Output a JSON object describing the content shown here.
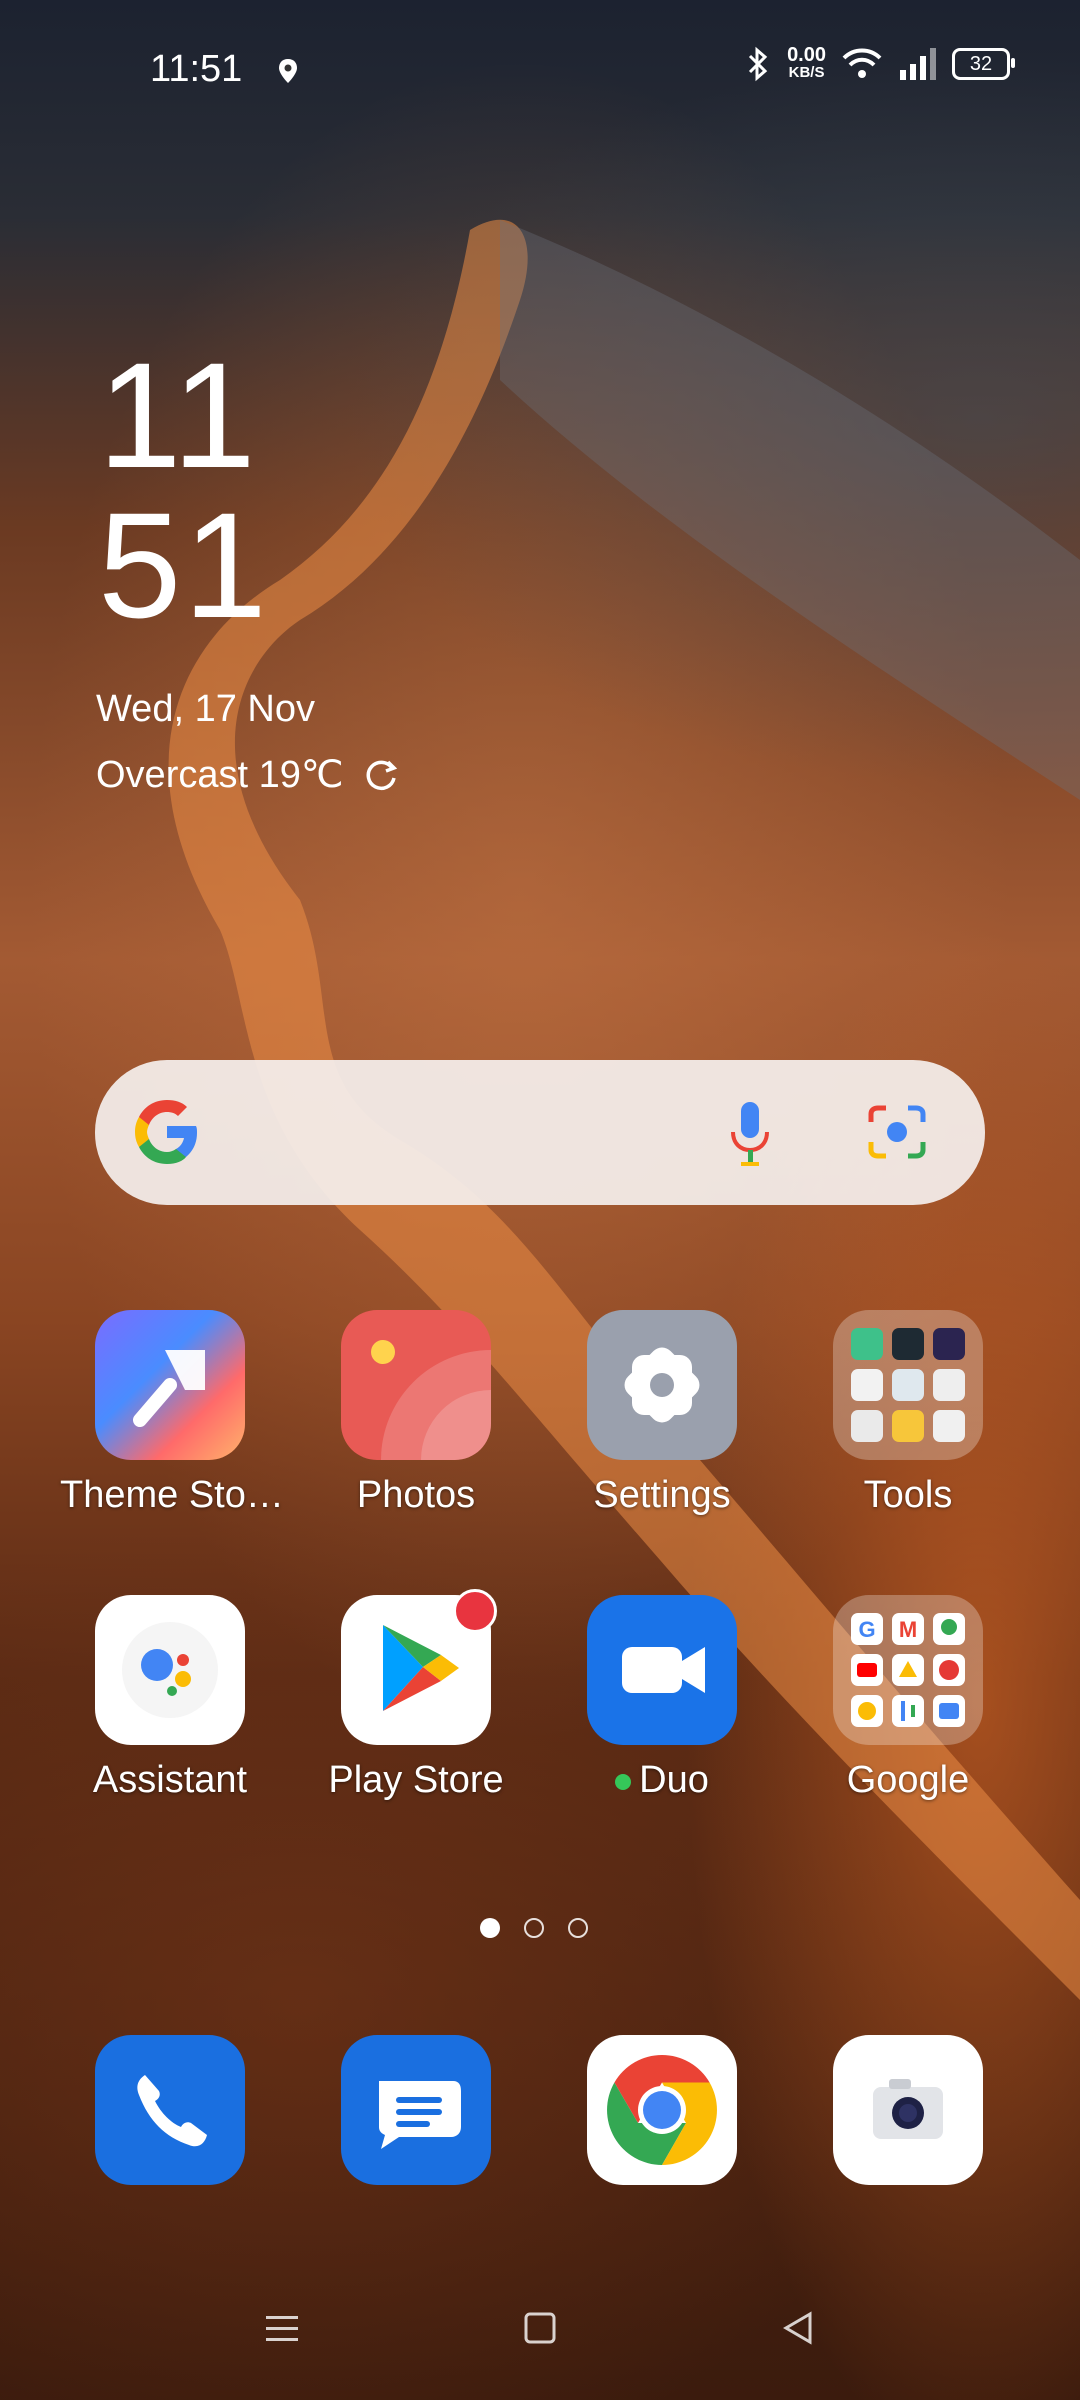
{
  "status_bar": {
    "time": "11:51",
    "net_speed_value": "0.00",
    "net_speed_unit": "KB/S",
    "battery": "32",
    "icons": [
      "location-icon",
      "bluetooth-icon",
      "wifi-icon",
      "signal-icon",
      "battery-icon"
    ]
  },
  "clock_widget": {
    "hour": "11",
    "minute": "51",
    "date": "Wed, 17 Nov",
    "weather": "Overcast 19℃"
  },
  "search_bar": {
    "icons": [
      "google-logo-icon",
      "microphone-icon",
      "lens-camera-icon"
    ]
  },
  "apps_row1": [
    {
      "label": "Theme Sto…",
      "icon": "theme-store-icon"
    },
    {
      "label": "Photos",
      "icon": "photos-icon"
    },
    {
      "label": "Settings",
      "icon": "settings-gear-icon"
    },
    {
      "label": "Tools",
      "icon": "tools-folder-icon"
    }
  ],
  "apps_row2": [
    {
      "label": "Assistant",
      "icon": "assistant-icon"
    },
    {
      "label": "Play Store",
      "icon": "play-store-icon",
      "badge": true
    },
    {
      "label": "Duo",
      "icon": "duo-video-icon",
      "status_dot": "#35c759"
    },
    {
      "label": "Google",
      "icon": "google-folder-icon"
    }
  ],
  "dock": [
    {
      "name": "Phone",
      "icon": "phone-icon"
    },
    {
      "name": "Messages",
      "icon": "messages-icon"
    },
    {
      "name": "Chrome",
      "icon": "chrome-icon"
    },
    {
      "name": "Camera",
      "icon": "camera-icon"
    }
  ],
  "page_indicator": {
    "pages": 3,
    "active": 1
  },
  "colors": {
    "duo_blue": "#1a73e8",
    "phone_blue": "#1a6fe0",
    "badge_red": "#e8343f",
    "photos_red": "#e85a55",
    "settings_gray": "#9aa0ad"
  }
}
